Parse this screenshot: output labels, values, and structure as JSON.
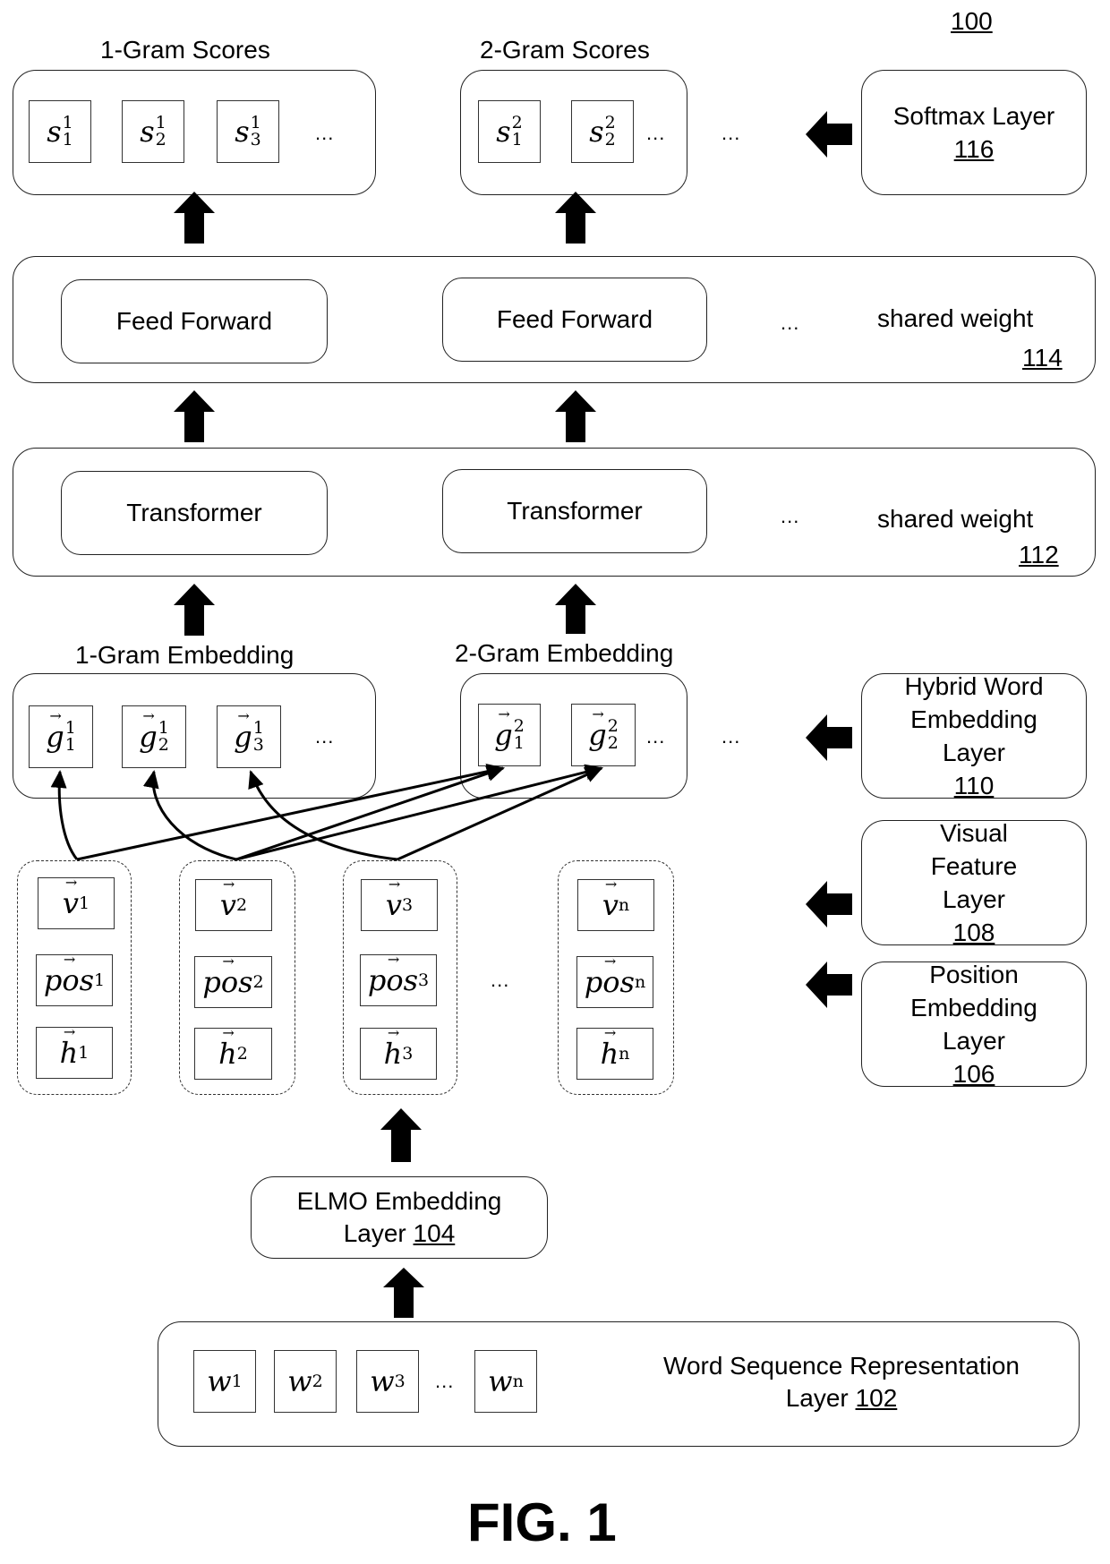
{
  "figure": {
    "reference": "100",
    "caption": "FIG. 1"
  },
  "scores": {
    "one_gram_title": "1-Gram Scores",
    "two_gram_title": "2-Gram Scores",
    "one_gram": [
      {
        "base": "s",
        "sub": "1",
        "sup": "1"
      },
      {
        "base": "s",
        "sub": "2",
        "sup": "1"
      },
      {
        "base": "s",
        "sub": "3",
        "sup": "1"
      }
    ],
    "two_gram": [
      {
        "base": "s",
        "sub": "1",
        "sup": "2"
      },
      {
        "base": "s",
        "sub": "2",
        "sup": "2"
      }
    ],
    "ellipsis": "..."
  },
  "softmax": {
    "label": "Softmax Layer",
    "ref": "116"
  },
  "feed_forward": {
    "block_label": "Feed Forward",
    "note": "shared weight",
    "ref": "114",
    "ellipsis": "..."
  },
  "transformer": {
    "block_label": "Transformer",
    "note": "shared weight",
    "ref": "112",
    "ellipsis": "..."
  },
  "embedding": {
    "one_gram_title": "1-Gram Embedding",
    "two_gram_title": "2-Gram Embedding",
    "one_gram": [
      {
        "base": "g",
        "sub": "1",
        "sup": "1"
      },
      {
        "base": "g",
        "sub": "2",
        "sup": "1"
      },
      {
        "base": "g",
        "sub": "3",
        "sup": "1"
      }
    ],
    "two_gram": [
      {
        "base": "g",
        "sub": "1",
        "sup": "2"
      },
      {
        "base": "g",
        "sub": "2",
        "sup": "2"
      }
    ],
    "ellipsis": "..."
  },
  "hybrid_layer": {
    "lines": [
      "Hybrid Word",
      "Embedding",
      "Layer"
    ],
    "ref": "110"
  },
  "visual_layer": {
    "lines": [
      "Visual",
      "Feature",
      "Layer"
    ],
    "ref": "108"
  },
  "position_layer": {
    "lines": [
      "Position",
      "Embedding",
      "Layer"
    ],
    "ref": "106"
  },
  "tokens": {
    "columns": [
      {
        "v": {
          "base": "v",
          "sub": "1"
        },
        "pos": {
          "base": "pos",
          "sub": "1"
        },
        "h": {
          "base": "h",
          "sub": "1"
        }
      },
      {
        "v": {
          "base": "v",
          "sub": "2"
        },
        "pos": {
          "base": "pos",
          "sub": "2"
        },
        "h": {
          "base": "h",
          "sub": "2"
        }
      },
      {
        "v": {
          "base": "v",
          "sub": "3"
        },
        "pos": {
          "base": "pos",
          "sub": "3"
        },
        "h": {
          "base": "h",
          "sub": "3"
        }
      },
      {
        "v": {
          "base": "v",
          "sub": "n"
        },
        "pos": {
          "base": "pos",
          "sub": "n"
        },
        "h": {
          "base": "h",
          "sub": "n"
        }
      }
    ],
    "ellipsis": "..."
  },
  "elmo": {
    "line1": "ELMO Embedding",
    "line2_prefix": "Layer ",
    "ref": "104"
  },
  "word_sequence": {
    "words": [
      {
        "base": "w",
        "sub": "1"
      },
      {
        "base": "w",
        "sub": "2"
      },
      {
        "base": "w",
        "sub": "3"
      },
      {
        "base": "w",
        "sub": "n"
      }
    ],
    "ellipsis": "...",
    "line1": "Word Sequence Representation",
    "line2_prefix": "Layer ",
    "ref": "102"
  }
}
